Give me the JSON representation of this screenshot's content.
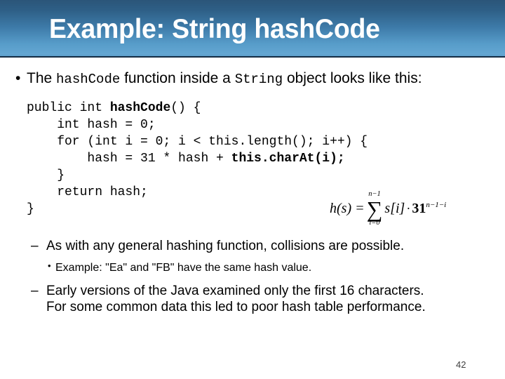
{
  "slide": {
    "title": "Example: String hashCode",
    "page_number": "42",
    "accent_color_dark": "#2b5579",
    "accent_color_light": "#63a6d2",
    "text_color": "#000000"
  },
  "intro": {
    "bullet_glyph": "•",
    "part1": "The ",
    "code1": "hashCode",
    "part2": " function inside a ",
    "code2": "String",
    "part3": " object looks like this:"
  },
  "code": {
    "line1_a": "public int ",
    "line1_b": "hashCode",
    "line1_c": "() {",
    "line2": "    int hash = 0;",
    "line3": "    for (int i = 0; i < this.length(); i++) {",
    "line4_a": "        hash = 31 * hash + ",
    "line4_b": "this.charAt(i);",
    "line5": "    }",
    "line6": "    return hash;",
    "line7": "}"
  },
  "formula": {
    "lhs": "h(s) = ",
    "sum_upper": "n−1",
    "sum_symbol": "∑",
    "sum_lower": "i=0",
    "term": "s[i]",
    "dot": "·",
    "base": "31",
    "exponent": "n−1−i"
  },
  "bullets": [
    {
      "glyph": "–",
      "text": "As with any general hashing function, collisions are possible."
    },
    {
      "glyph": "•",
      "text": "Example: \"Ea\" and \"FB\" have the same hash value."
    },
    {
      "glyph": "–",
      "line1": "Early versions of the Java examined only the first 16 characters.",
      "line2": "For some common data this led to poor hash table performance."
    }
  ]
}
